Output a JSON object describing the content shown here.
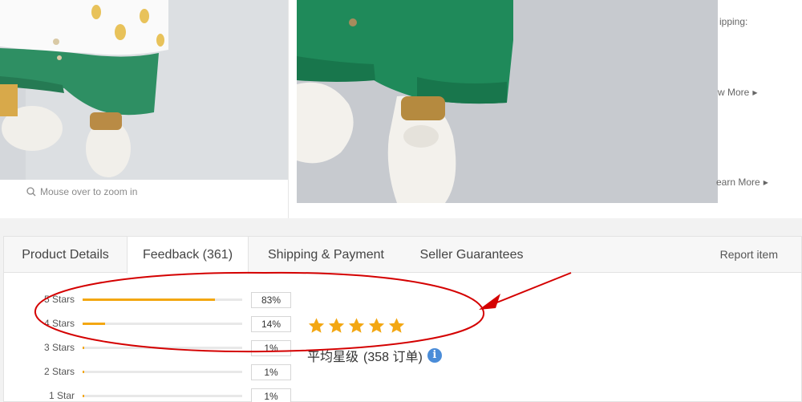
{
  "gallery": {
    "zoom_hint": "Mouse over to zoom in",
    "side_text_1": "ipping:",
    "view_more": "w More",
    "learn_more": "earn More"
  },
  "tabs": [
    {
      "label": "Product Details"
    },
    {
      "label": "Feedback (361)"
    },
    {
      "label": "Shipping & Payment"
    },
    {
      "label": "Seller Guarantees"
    }
  ],
  "report_item": "Report item",
  "feedback": {
    "rows": [
      {
        "label": "5 Stars",
        "pct": "83%",
        "fill": 0.83
      },
      {
        "label": "4 Stars",
        "pct": "14%",
        "fill": 0.14
      },
      {
        "label": "3 Stars",
        "pct": "1%",
        "fill": 0.01
      },
      {
        "label": "2 Stars",
        "pct": "1%",
        "fill": 0.01
      },
      {
        "label": "1 Star",
        "pct": "1%",
        "fill": 0.01
      }
    ],
    "star_count": 5,
    "average_text": "平均星级",
    "orders_text": "(358 订单)",
    "info_icon": "info-icon"
  },
  "colors": {
    "accent": "#f3a712",
    "annotation": "#d40000",
    "shorts_green": "#1f8a5a"
  }
}
